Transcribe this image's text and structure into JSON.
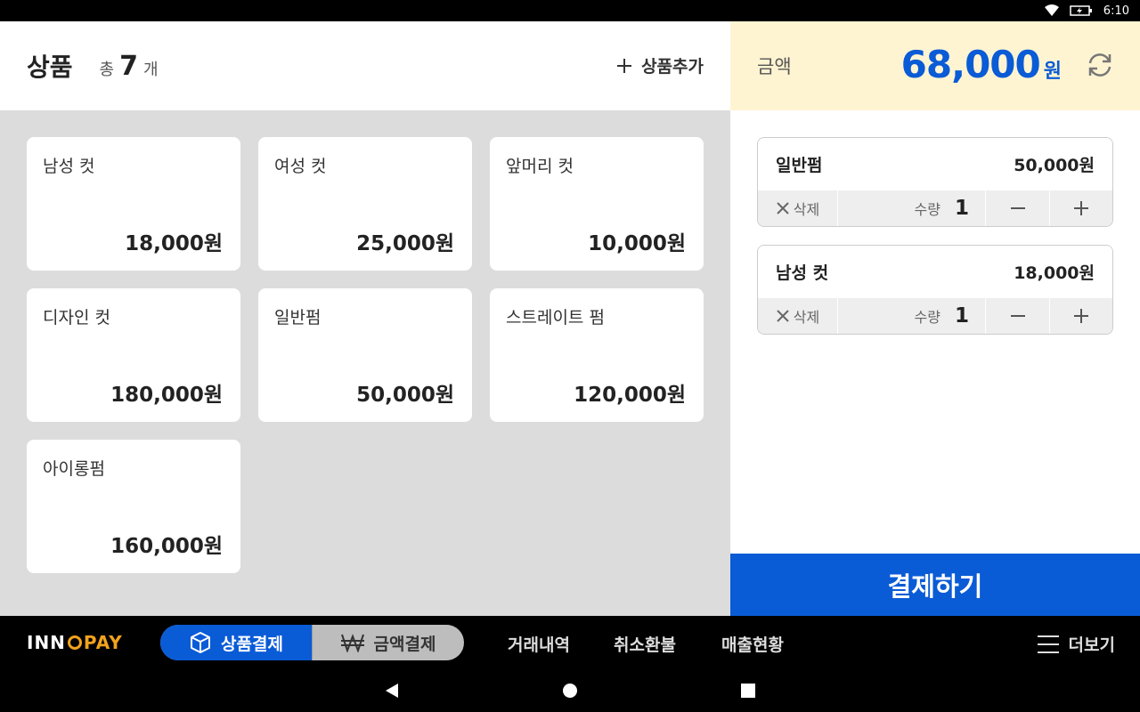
{
  "status_bar": {
    "time": "6:10",
    "icons": [
      "wifi-icon",
      "battery-icon"
    ]
  },
  "products_panel": {
    "title": "상품",
    "count_prefix": "총",
    "count": "7",
    "count_suffix": "개",
    "add_label": "상품추가",
    "items": [
      {
        "name": "남성 컷",
        "price": "18,000원"
      },
      {
        "name": "여성 컷",
        "price": "25,000원"
      },
      {
        "name": "앞머리 컷",
        "price": "10,000원"
      },
      {
        "name": "디자인 컷",
        "price": "180,000원"
      },
      {
        "name": "일반펌",
        "price": "50,000원"
      },
      {
        "name": "스트레이트 펌",
        "price": "120,000원"
      },
      {
        "name": "아이롱펌",
        "price": "160,000원"
      }
    ]
  },
  "order_panel": {
    "amount_label": "금액",
    "amount_value": "68,000",
    "amount_unit": "원",
    "cart": [
      {
        "name": "일반펌",
        "price": "50,000원",
        "delete_label": "삭제",
        "qty_label": "수량",
        "qty": "1"
      },
      {
        "name": "남성 컷",
        "price": "18,000원",
        "delete_label": "삭제",
        "qty_label": "수량",
        "qty": "1"
      }
    ],
    "pay_label": "결제하기"
  },
  "bottom_nav": {
    "logo_left": "INN",
    "logo_right": "PAY",
    "tab_product": "상품결제",
    "tab_amount": "금액결제",
    "link_history": "거래내역",
    "link_refund": "취소환불",
    "link_sales": "매출현황",
    "more_label": "더보기"
  },
  "colors": {
    "accent": "#0a5bd6",
    "amount_bg": "#fff4d2",
    "logo_orange": "#f2a21c"
  }
}
